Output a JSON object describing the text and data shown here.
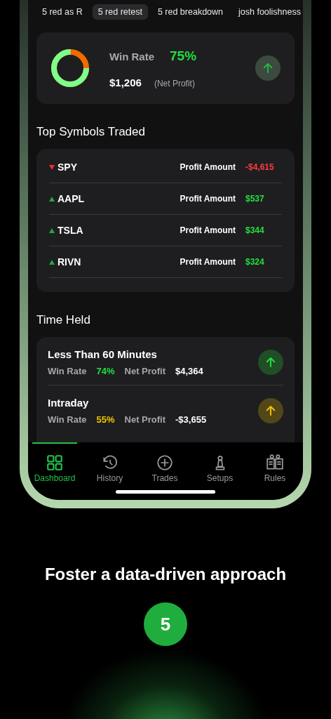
{
  "filter_tabs": [
    {
      "label": "5 red as R",
      "selected": false
    },
    {
      "label": "5 red retest",
      "selected": true
    },
    {
      "label": "5 red breakdown",
      "selected": false
    },
    {
      "label": "josh foolishness",
      "selected": false
    }
  ],
  "summary": {
    "win_rate_label": "Win Rate",
    "win_rate": "75%",
    "level": 0.75,
    "net_profit": "$1,206",
    "net_profit_label": "(Net Profit)"
  },
  "top_symbols": {
    "title": "Top Symbols Traded",
    "rows": [
      {
        "symbol": "SPY",
        "loss": true,
        "profit_label": "Profit Amount",
        "amount": "-$4,615"
      },
      {
        "symbol": "AAPL",
        "loss": false,
        "profit_label": "Profit Amount",
        "amount": "$537"
      },
      {
        "symbol": "TSLA",
        "loss": false,
        "profit_label": "Profit Amount",
        "amount": "$344"
      },
      {
        "symbol": "RIVN",
        "loss": false,
        "profit_label": "Profit Amount",
        "amount": "$324"
      }
    ]
  },
  "time_held": {
    "title": "Time Held",
    "rows": [
      {
        "title": "Less Than 60 Minutes",
        "color": "#22e03c",
        "win_rate_label": "Win Rate",
        "win_rate": "74%",
        "net_profit_label": "Net Profit",
        "net_profit": "$4,364"
      },
      {
        "title": "Intraday",
        "color": "#f2c400",
        "win_rate_label": "Win Rate",
        "win_rate": "55%",
        "net_profit_label": "Net Profit",
        "net_profit": "-$3,655"
      }
    ]
  },
  "nav": [
    {
      "label": "Dashboard",
      "selected": true
    },
    {
      "label": "History",
      "selected": false
    },
    {
      "label": "Trades",
      "selected": false
    },
    {
      "label": "Setups",
      "selected": false
    },
    {
      "label": "Rules",
      "selected": false
    }
  ],
  "footer": {
    "headline": "Foster a data-driven approach",
    "step": "5"
  }
}
